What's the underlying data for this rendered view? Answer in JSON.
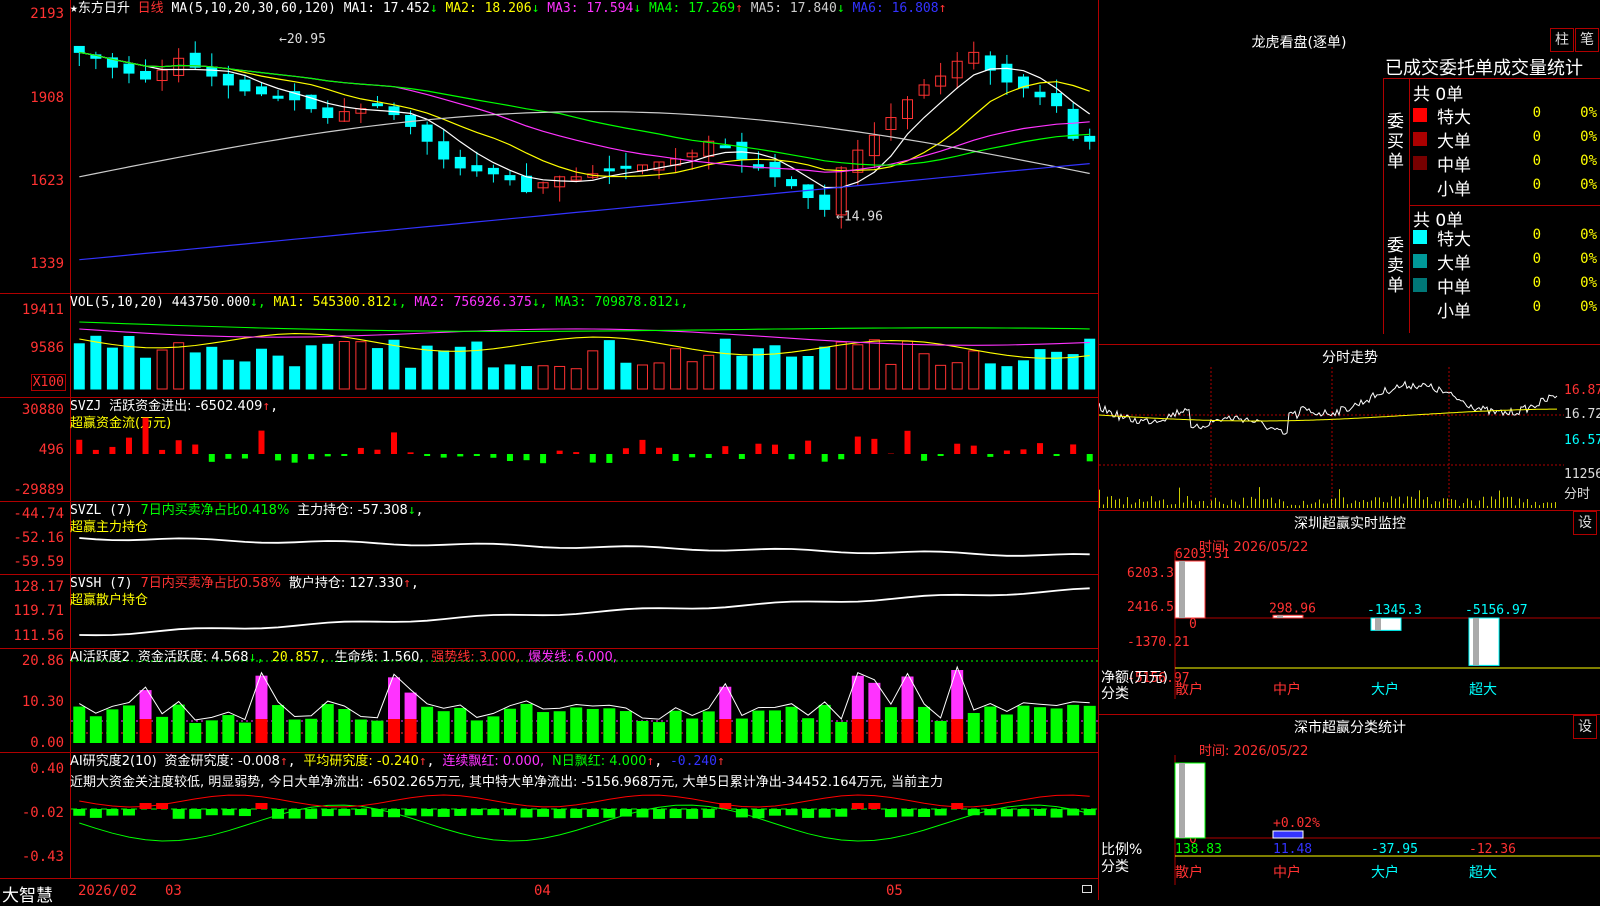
{
  "stock": {
    "star": "★",
    "name": "东方日升",
    "period": "日线"
  },
  "main": {
    "ma_label": "MA(5,10,20,30,60,120)",
    "ma": [
      {
        "name": "MA1",
        "value": "17.452",
        "dir": "↓",
        "color": "#ffffff"
      },
      {
        "name": "MA2",
        "value": "18.206",
        "dir": "↓",
        "color": "#ffff00"
      },
      {
        "name": "MA3",
        "value": "17.594",
        "dir": "↓",
        "color": "#ff33ff"
      },
      {
        "name": "MA4",
        "value": "17.269",
        "dir": "↑",
        "color": "#00ff00"
      },
      {
        "name": "MA5",
        "value": "17.840",
        "dir": "↓",
        "color": "#cccccc"
      },
      {
        "name": "MA6",
        "value": "16.808",
        "dir": "↑",
        "color": "#3333ff"
      }
    ],
    "yticks": [
      "2193",
      "1908",
      "1623",
      "1339"
    ],
    "high_label": "20.95",
    "low_label": "14.96"
  },
  "vol": {
    "label": "VOL(5,10,20)",
    "value": "443750.000",
    "ma": [
      {
        "name": "MA1",
        "value": "545300.812",
        "color": "#ffff00"
      },
      {
        "name": "MA2",
        "value": "756926.375",
        "color": "#ff33ff"
      },
      {
        "name": "MA3",
        "value": "709878.812",
        "color": "#00ff00"
      }
    ],
    "yticks": [
      "19411",
      "9586",
      "X100"
    ]
  },
  "svzj": {
    "label": "SVZJ",
    "text": "活跃资金进出: -6502.409",
    "sub": "超赢资金流(万元)",
    "yticks": [
      "30880",
      "496",
      "-29889"
    ]
  },
  "svzl": {
    "label": "SVZL (7)",
    "text1": "7日内买卖净占比0.418%",
    "text2": "主力持仓: -57.308",
    "sub": "超赢主力持仓",
    "yticks": [
      "-44.74",
      "-52.16",
      "-59.59"
    ]
  },
  "svsh": {
    "label": "SVSH (7)",
    "text1": "7日内买卖净占比0.58%",
    "text2": "散户持仓: 127.330",
    "sub": "超赢散户持仓",
    "yticks": [
      "128.17",
      "119.71",
      "111.56"
    ]
  },
  "ai_act": {
    "label": "AI活跃度2",
    "t1": "资金活跃度: 4.568",
    "t2": "20.857,",
    "t3": "生命线: 1.560,",
    "t4": "强势线: 3.000,",
    "t5": "爆发线: 6.000,",
    "yticks": [
      "20.86",
      "10.30",
      "0.00"
    ]
  },
  "ai_res": {
    "label": "AI研究度2(10)",
    "t1": "资金研究度: -0.008",
    "t2": "平均研究度: -0.240",
    "t3": "连续飘红: 0.000,",
    "t4": "N日飘红: 4.000",
    "t5": "-0.240",
    "note": "近期大资金关注度较低, 明显弱势, 今日大单净流出: -6502.265万元, 其中特大单净流出: -5156.968万元, 大单5日累计净出-34452.164万元, 当前主力",
    "yticks": [
      "0.40",
      "-0.02",
      "-0.43"
    ]
  },
  "bottom": {
    "brand": "大智慧",
    "dates": [
      "2026/02",
      "03",
      "04",
      "05"
    ]
  },
  "lhb": {
    "title": "龙虎看盘(逐单)",
    "btn1": "柱",
    "btn2": "笔",
    "subtitle": "已成交委托单成交量统计",
    "buy_label": "委买单",
    "sell_label": "委卖单",
    "buy_total": "共 0单",
    "sell_total": "共 0单",
    "buy_rows": [
      {
        "name": "特大",
        "color": "#ff0000",
        "n": "0",
        "p": "0%"
      },
      {
        "name": "大单",
        "color": "#aa0000",
        "n": "0",
        "p": "0%"
      },
      {
        "name": "中单",
        "color": "#770000",
        "n": "0",
        "p": "0%"
      },
      {
        "name": "小单",
        "color": "",
        "n": "0",
        "p": "0%"
      }
    ],
    "sell_rows": [
      {
        "name": "特大",
        "color": "#00ffff",
        "n": "0",
        "p": "0%"
      },
      {
        "name": "大单",
        "color": "#009999",
        "n": "0",
        "p": "0%"
      },
      {
        "name": "中单",
        "color": "#007777",
        "n": "0",
        "p": "0%"
      },
      {
        "name": "小单",
        "color": "",
        "n": "0",
        "p": "0%"
      }
    ]
  },
  "intraday": {
    "title": "分时走势",
    "yticks": [
      "16.87",
      "16.72",
      "16.57"
    ],
    "vol_tick": "11256",
    "vol_label": "分时"
  },
  "sz_monitor": {
    "title": "深圳超赢实时监控",
    "btn": "设",
    "time": "时间: 2026/05/22",
    "yticks": [
      "6203.31",
      "2416.55",
      "0",
      "-1370.21",
      "-5156.97"
    ],
    "unit": "净额(万元)",
    "cat_label": "分类",
    "bars": [
      {
        "cat": "散户",
        "value": "6203.31",
        "v": 6203.31
      },
      {
        "cat": "中户",
        "value": "298.96",
        "v": 298.96
      },
      {
        "cat": "大户",
        "value": "-1345.3",
        "v": -1345.3
      },
      {
        "cat": "超大",
        "value": "-5156.97",
        "v": -5156.97
      }
    ]
  },
  "sz_class": {
    "title": "深市超赢分类统计",
    "btn": "设",
    "time": "时间: 2026/05/22",
    "yticks": [
      "75",
      "50",
      "25",
      "0"
    ],
    "unit": "比例%",
    "cat_label": "分类",
    "bars": [
      {
        "cat": "散户",
        "value": "138.83",
        "v": 138.83
      },
      {
        "cat": "中户",
        "value": "11.48",
        "v": 11.48
      },
      {
        "cat": "大户",
        "value": "-37.95",
        "v": -37.95
      },
      {
        "cat": "超大",
        "value": "-12.36",
        "v": -12.36
      }
    ],
    "mid_note": "+0.02%"
  },
  "chart_data": [
    {
      "type": "line",
      "title": "东方日升 日线",
      "y_range": [
        13.39,
        21.93
      ],
      "markers": [
        {
          "label": "20.95",
          "value": 20.95
        },
        {
          "label": "14.96",
          "value": 14.96
        }
      ],
      "series": [
        {
          "name": "MA1",
          "value": 17.452
        },
        {
          "name": "MA2",
          "value": 18.206
        },
        {
          "name": "MA3",
          "value": 17.594
        },
        {
          "name": "MA4",
          "value": 17.269
        },
        {
          "name": "MA5",
          "value": 17.84
        },
        {
          "name": "MA6",
          "value": 16.808
        }
      ]
    },
    {
      "type": "bar",
      "title": "深圳超赢实时监控",
      "categories": [
        "散户",
        "中户",
        "大户",
        "超大"
      ],
      "values": [
        6203.31,
        298.96,
        -1345.3,
        -5156.97
      ],
      "ylabel": "净额(万元)"
    },
    {
      "type": "bar",
      "title": "深市超赢分类统计",
      "categories": [
        "散户",
        "中户",
        "大户",
        "超大"
      ],
      "values": [
        138.83,
        11.48,
        -37.95,
        -12.36
      ],
      "ylabel": "比例%"
    }
  ]
}
